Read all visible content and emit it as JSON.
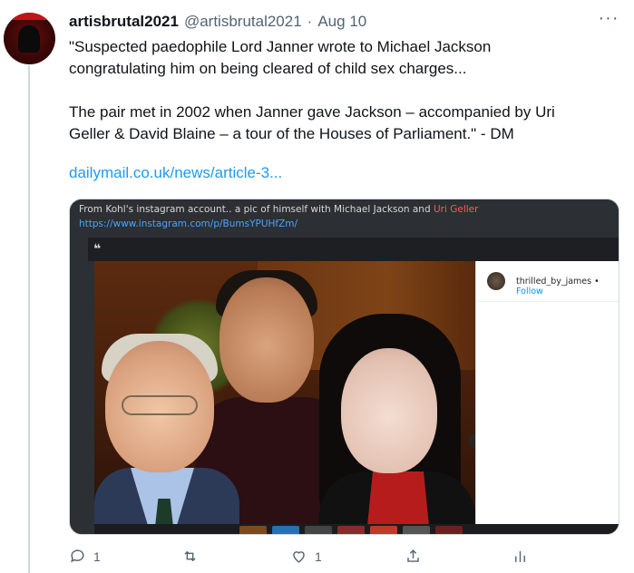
{
  "tweet": {
    "author_name": "artisbrutal2021",
    "author_handle": "@artisbrutal2021",
    "separator": "·",
    "date": "Aug 10",
    "more_label": "···",
    "text_line1": "\"Suspected paedophile Lord Janner wrote to Michael Jackson",
    "text_line2": "congratulating him on being cleared of child sex charges...",
    "text_line3": "The pair met in 2002 when Janner gave Jackson – accompanied by Uri",
    "text_line4": "Geller &  David Blaine – a tour of the Houses of Parliament.\" - DM",
    "link_text": "dailymail.co.uk/news/article-3..."
  },
  "media": {
    "caption_prefix": "From Kohl's instagram account.. a pic of himself with Michael Jackson and ",
    "caption_highlight": "Uri Geller",
    "caption_url": "https://www.instagram.com/p/BumsYPUHfZm/",
    "quote_mark": "❝",
    "instagram_user": "thrilled_by_james",
    "instagram_separator": " • ",
    "instagram_follow": "Follow",
    "next_icon": "›"
  },
  "actions": {
    "reply_count": "1",
    "retweet_count": "",
    "like_count": "1"
  },
  "colors": {
    "link": "#1d9bf0",
    "muted": "#536471",
    "caption_red": "#ff5a5a"
  }
}
